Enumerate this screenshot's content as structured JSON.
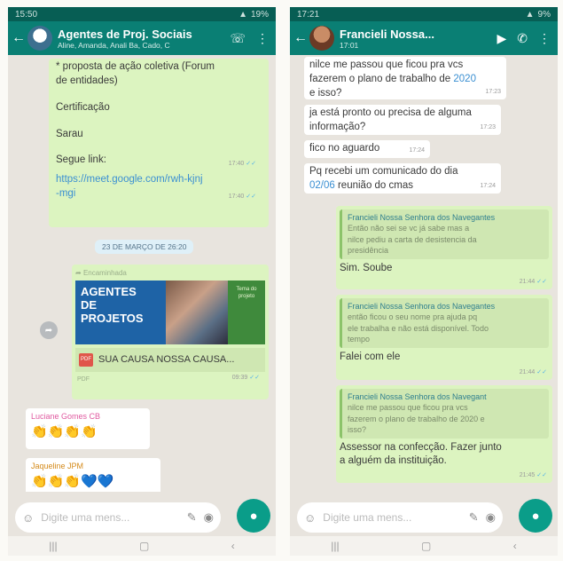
{
  "left": {
    "status": {
      "time": "15:50",
      "battery": "19%"
    },
    "header": {
      "title": "Agentes de Proj. Sociais",
      "subtitle": "Aline, Amanda, Anali Ba, Cado, C"
    },
    "msg1": {
      "line1": "* proposta de ação coletiva (Forum",
      "line2": "de entidades)",
      "line3": "Certificação",
      "line4": "Sarau",
      "line5": "Segue link:",
      "link1": "https://meet.google.com/rwh-kjnj",
      "link2": "-mgi",
      "time1": "17:40",
      "time2": "17:40"
    },
    "date_chip": "23 DE MARÇO DE 26:20",
    "doc": {
      "forwarded": "Encaminhada",
      "thumb_line1": "AGENTES",
      "thumb_line2": "DE",
      "thumb_line3": "PROJETOS",
      "thumb_side": "Tema do projeto",
      "filename": "SUA CAUSA NOSSA CAUSA...",
      "type": "PDF",
      "time": "09:39"
    },
    "msg_luciane": {
      "sender": "Luciane Gomes CB",
      "content": "👏👏👏👏"
    },
    "msg_jaqueline": {
      "sender": "Jaqueline JPM",
      "content": "👏👏👏💙💙"
    },
    "input_placeholder": "Digite uma mens..."
  },
  "right": {
    "status": {
      "time": "17:21",
      "battery": "9%"
    },
    "header": {
      "title": "Francieli Nossa...",
      "subtitle": "17:01"
    },
    "m1": {
      "line1": "nilce me passou que ficou pra vcs",
      "line2a": "fazerem o plano de trabalho de ",
      "year": "2020",
      "line3": "e isso?",
      "time": "17:23"
    },
    "m2": {
      "line1": "ja está pronto ou precisa de alguma",
      "line2": "informação?",
      "time": "17:23"
    },
    "m3": {
      "text": "fico no aguardo",
      "time": "17:24"
    },
    "m4": {
      "line1": "Pq recebi um comunicado do dia",
      "date": "02/06",
      "line2b": " reunião do cmas",
      "time": "17:24"
    },
    "r1": {
      "author": "Francieli Nossa Senhora dos Navegantes",
      "q1": "Então não sei se vc já sabe mas a",
      "q2": "nilce pediu a carta de desistencia da",
      "q3": "presidência",
      "text": "Sim. Soube",
      "time": "21:44"
    },
    "r2": {
      "author": "Francieli Nossa Senhora dos Navegantes",
      "q1": "então ficou o seu nome pra ajuda pq",
      "q2": "ele trabalha e não está disponível. Todo",
      "q3": "tempo",
      "text": "Falei com ele",
      "time": "21:44"
    },
    "r3": {
      "author": "Francieli Nossa Senhora dos Navegant",
      "q1": "nilce me passou que ficou pra vcs",
      "q2": "fazerem o plano de trabalho de 2020 e",
      "q3": "isso?",
      "text1": "Assessor na confecção. Fazer junto",
      "text2": "a alguém da instituição.",
      "time": "21:45"
    },
    "input_placeholder": "Digite uma mens..."
  },
  "colors": {
    "header": "#0a7f74",
    "outgoing": "#dcf4c0",
    "incoming": "#ffffff",
    "accent": "#0a9d89"
  },
  "icons": [
    "back-arrow-icon",
    "add-person-icon",
    "more-icon",
    "video-icon",
    "phone-icon",
    "emoji-icon",
    "attach-icon",
    "camera-icon",
    "mic-icon"
  ]
}
